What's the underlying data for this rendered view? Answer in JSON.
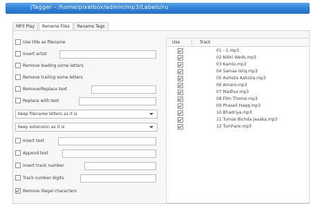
{
  "window": {
    "title": "jTagger - /home/pixelbox/admin/mp3/Labels/ru"
  },
  "tabs": [
    "MP3 Play",
    "Rename Files",
    "Rename Tags"
  ],
  "left": {
    "use_title": "Use title as filename",
    "insert_artist": "Insert artist",
    "remove_leading_letters": "Remove leading some letters",
    "remove_trailing": "Remove trailing some letters",
    "remove_replace": "Remove/Replace text",
    "replace_with": "Replace with text",
    "select1": "Keep filename letters as it is",
    "select2": "Keep extension as it is",
    "insert_text": "Insert text",
    "append_text": "Append text",
    "insert_track": "Insert track number",
    "track_digits": "Track number digits",
    "remove_illegal": "Remove illegal characters"
  },
  "table": {
    "col_use": "Use",
    "col_track": "Track",
    "rows": [
      "01 - 1.mp3",
      "02 Nikki Weds.mp3",
      "03 Kamlo.mp3",
      "04 Sainaa Ishq.mp3",
      "05 Aahista Aahista.mp3",
      "06 Amaro.mp3",
      "07 Madhur.mp3",
      "08 Film Theme.mp3",
      "09 Phaseli Haqq.mp3",
      "10 Bhadriya.mp3",
      "11 Tumse Bichda Jaaaka.mp3",
      "12 Tumhare.mp3"
    ]
  }
}
